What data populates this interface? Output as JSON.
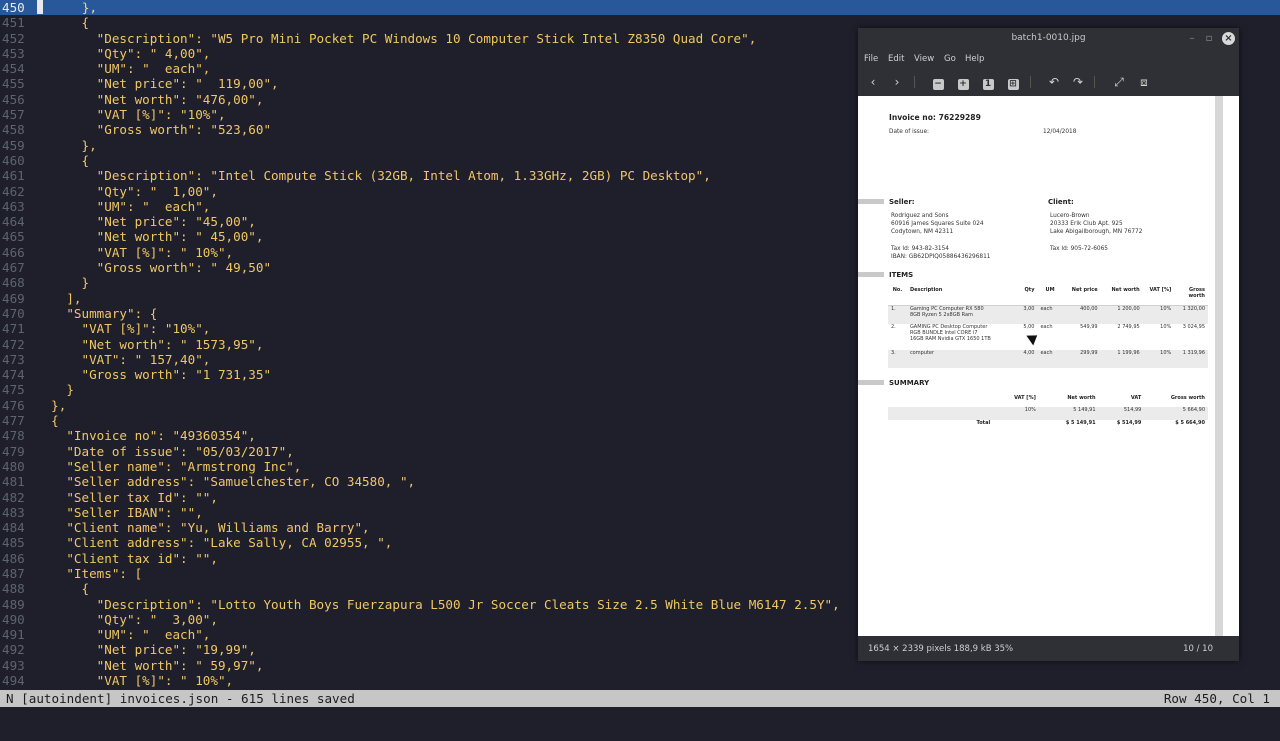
{
  "editor": {
    "lines": [
      {
        "n": "450",
        "text": "      },",
        "current": true
      },
      {
        "n": "451",
        "text": "      {"
      },
      {
        "n": "452",
        "text": "        \"Description\": \"W5 Pro Mini Pocket PC Windows 10 Computer Stick Intel Z8350 Quad Core\","
      },
      {
        "n": "453",
        "text": "        \"Qty\": \" 4,00\","
      },
      {
        "n": "454",
        "text": "        \"UM\": \"  each\","
      },
      {
        "n": "455",
        "text": "        \"Net price\": \"  119,00\","
      },
      {
        "n": "456",
        "text": "        \"Net worth\": \"476,00\","
      },
      {
        "n": "457",
        "text": "        \"VAT [%]\": \"10%\","
      },
      {
        "n": "458",
        "text": "        \"Gross worth\": \"523,60\""
      },
      {
        "n": "459",
        "text": "      },"
      },
      {
        "n": "460",
        "text": "      {"
      },
      {
        "n": "461",
        "text": "        \"Description\": \"Intel Compute Stick (32GB, Intel Atom, 1.33GHz, 2GB) PC Desktop\","
      },
      {
        "n": "462",
        "text": "        \"Qty\": \"  1,00\","
      },
      {
        "n": "463",
        "text": "        \"UM\": \"  each\","
      },
      {
        "n": "464",
        "text": "        \"Net price\": \"45,00\","
      },
      {
        "n": "465",
        "text": "        \"Net worth\": \" 45,00\","
      },
      {
        "n": "466",
        "text": "        \"VAT [%]\": \" 10%\","
      },
      {
        "n": "467",
        "text": "        \"Gross worth\": \" 49,50\""
      },
      {
        "n": "468",
        "text": "      }"
      },
      {
        "n": "469",
        "text": "    ],"
      },
      {
        "n": "470",
        "text": "    \"Summary\": {"
      },
      {
        "n": "471",
        "text": "      \"VAT [%]\": \"10%\","
      },
      {
        "n": "472",
        "text": "      \"Net worth\": \" 1573,95\","
      },
      {
        "n": "473",
        "text": "      \"VAT\": \" 157,40\","
      },
      {
        "n": "474",
        "text": "      \"Gross worth\": \"1 731,35\""
      },
      {
        "n": "475",
        "text": "    }"
      },
      {
        "n": "476",
        "text": "  },"
      },
      {
        "n": "477",
        "text": "  {"
      },
      {
        "n": "478",
        "text": "    \"Invoice no\": \"49360354\","
      },
      {
        "n": "479",
        "text": "    \"Date of issue\": \"05/03/2017\","
      },
      {
        "n": "480",
        "text": "    \"Seller name\": \"Armstrong Inc\","
      },
      {
        "n": "481",
        "text": "    \"Seller address\": \"Samuelchester, CO 34580, \","
      },
      {
        "n": "482",
        "text": "    \"Seller tax Id\": \"\","
      },
      {
        "n": "483",
        "text": "    \"Seller IBAN\": \"\","
      },
      {
        "n": "484",
        "text": "    \"Client name\": \"Yu, Williams and Barry\","
      },
      {
        "n": "485",
        "text": "    \"Client address\": \"Lake Sally, CA 02955, \","
      },
      {
        "n": "486",
        "text": "    \"Client tax id\": \"\","
      },
      {
        "n": "487",
        "text": "    \"Items\": ["
      },
      {
        "n": "488",
        "text": "      {"
      },
      {
        "n": "489",
        "text": "        \"Description\": \"Lotto Youth Boys Fuerzapura L500 Jr Soccer Cleats Size 2.5 White Blue M6147 2.5Y\","
      },
      {
        "n": "490",
        "text": "        \"Qty\": \"  3,00\","
      },
      {
        "n": "491",
        "text": "        \"UM\": \"  each\","
      },
      {
        "n": "492",
        "text": "        \"Net price\": \"19,99\","
      },
      {
        "n": "493",
        "text": "        \"Net worth\": \" 59,97\","
      },
      {
        "n": "494",
        "text": "        \"VAT [%]\": \" 10%\","
      }
    ]
  },
  "status": {
    "left": "N [autoindent] invoices.json - 615 lines saved",
    "right": "Row 450, Col 1"
  },
  "viewer": {
    "title": "batch1-0010.jpg",
    "menu": [
      "File",
      "Edit",
      "View",
      "Go",
      "Help"
    ],
    "status_info": "1654 × 2339 pixels  188,9 kB   35%",
    "page": "10 / 10"
  },
  "invoice": {
    "title": "Invoice no: 76229289",
    "date_label": "Date of issue:",
    "date_value": "12/04/2018",
    "seller": {
      "heading": "Seller:",
      "name": "Rodriguez and Sons",
      "address1": "60916 James Squares Suite 024",
      "address2": "Codytown, NM 42311",
      "tax": "Tax Id: 943-82-3154",
      "iban": "IBAN: GB62DPIQ05886436296811"
    },
    "client": {
      "heading": "Client:",
      "name": "Lucero-Brown",
      "address1": "20333 Erik Club Apt. 925",
      "address2": "Lake Abigailborough, MN 76772",
      "tax": "Tax Id: 905-72-6065"
    },
    "items_heading": "ITEMS",
    "items_headers": [
      "No.",
      "Description",
      "Qty",
      "UM",
      "Net price",
      "Net worth",
      "VAT [%]",
      "Gross worth"
    ],
    "items": [
      {
        "no": "1.",
        "desc1": "Gaming PC Computer RX 580",
        "desc2": "8GB Ryzen 5 2x8GB Ram",
        "desc3": "",
        "qty": "3,00",
        "um": "each",
        "price": "400,00",
        "net": "1 200,00",
        "vat": "10%",
        "gross": "1 320,00"
      },
      {
        "no": "2.",
        "desc1": "GAMING PC Desktop Computer",
        "desc2": "RGB BUNDLE Intel CORE i7",
        "desc3": "16GB RAM Nvidia GTX 1650 1TB",
        "qty": "5,00",
        "um": "each",
        "price": "549,99",
        "net": "2 749,95",
        "vat": "10%",
        "gross": "3 024,95"
      },
      {
        "no": "3.",
        "desc1": "computer",
        "desc2": "",
        "desc3": "",
        "qty": "4,00",
        "um": "each",
        "price": "299,99",
        "net": "1 199,96",
        "vat": "10%",
        "gross": "1 319,96"
      }
    ],
    "summary_heading": "SUMMARY",
    "summary_headers": [
      "VAT [%]",
      "Net worth",
      "VAT",
      "Gross worth"
    ],
    "summary_row": {
      "vat_pct": "10%",
      "net": "5 149,91",
      "vat": "514,99",
      "gross": "5 664,90"
    },
    "summary_total": {
      "label": "Total",
      "net": "$ 5 149,91",
      "vat": "$ 514,99",
      "gross": "$ 5 664,90"
    }
  }
}
